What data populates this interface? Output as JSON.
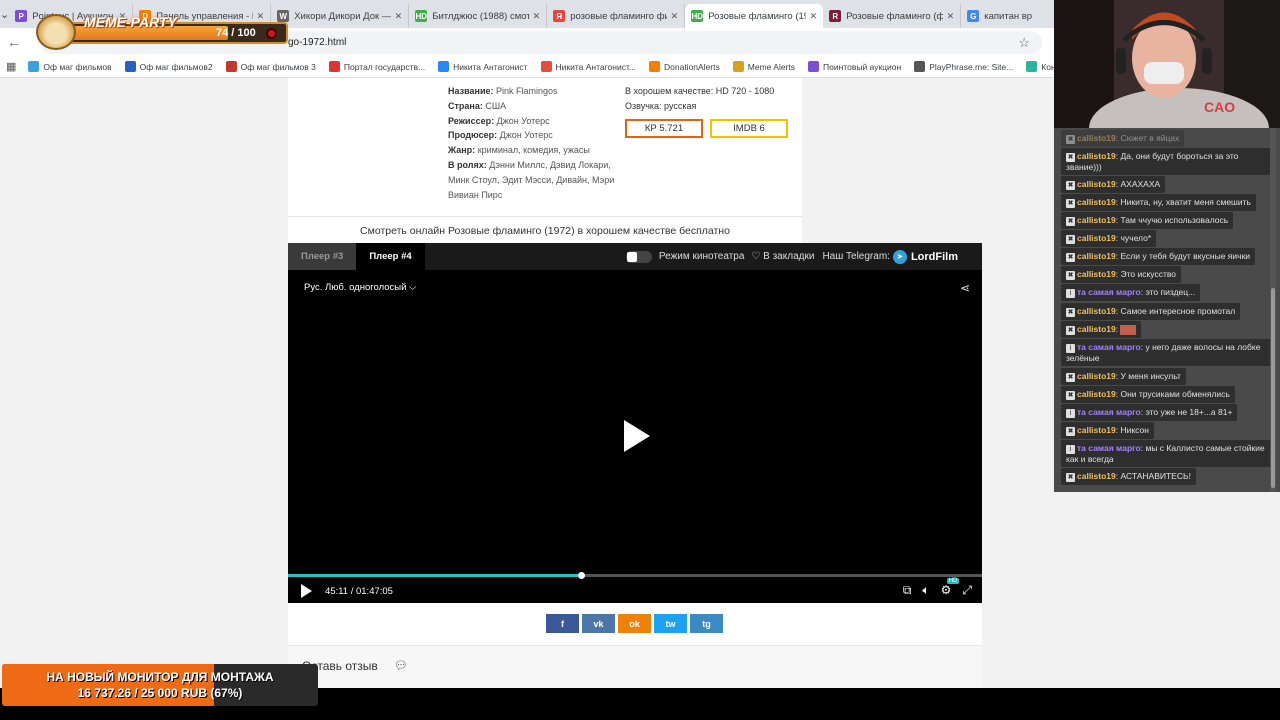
{
  "browser": {
    "tabs": [
      {
        "title": "Pointauc | Аукцион для",
        "fav": "P",
        "color": "#7a4fd6"
      },
      {
        "title": "Панель управления - Do",
        "fav": "D",
        "color": "#f57d00"
      },
      {
        "title": "Хикори Дикори Док — В",
        "fav": "W",
        "color": "#666666"
      },
      {
        "title": "Битлджюс (1988) смотре",
        "fav": "HD",
        "color": "#3fae49"
      },
      {
        "title": "розовые фламинго филь",
        "fav": "Я",
        "color": "#e8453c"
      },
      {
        "title": "Розовые фламинго (1972",
        "fav": "HD",
        "color": "#3fae49"
      },
      {
        "title": "Розовые фламинго (фил",
        "fav": "R",
        "color": "#7a1f3a"
      },
      {
        "title": "капитан вр",
        "fav": "G",
        "color": "#4285f4"
      }
    ],
    "active_tab": 5,
    "url": "go-1972.html",
    "bookmarks": [
      {
        "label": "Оф маг фильмов",
        "color": "#3aa0e0"
      },
      {
        "label": "Оф маг фильмов2",
        "color": "#2a60c0"
      },
      {
        "label": "Оф маг фильмов 3",
        "color": "#c0392b"
      },
      {
        "label": "Портал государств...",
        "color": "#d33"
      },
      {
        "label": "Никита Антагонист",
        "color": "#2787f5"
      },
      {
        "label": "Никита Антагонист...",
        "color": "#e74c3c"
      },
      {
        "label": "DonationAlerts",
        "color": "#f57d00"
      },
      {
        "label": "Meme Alerts",
        "color": "#d6a21e"
      },
      {
        "label": "Поинтовый аукцион",
        "color": "#7a4fd6"
      },
      {
        "label": "PlayPhrase.me: Site...",
        "color": "#555555"
      },
      {
        "label": "Контур.Сайн – Док...",
        "color": "#2ab5a0"
      }
    ]
  },
  "movie": {
    "info_left": [
      {
        "k": "Название:",
        "v": "Pink Flamingos"
      },
      {
        "k": "Страна:",
        "v": "США"
      },
      {
        "k": "Режиссер:",
        "v": "Джон Уотерс"
      },
      {
        "k": "Продюсер:",
        "v": "Джон Уотерс"
      },
      {
        "k": "Жанр:",
        "v": "криминал, комедия, ужасы"
      },
      {
        "k": "В ролях:",
        "v": "Дэнни Миллс, Дэвид Локари, Минк Стоул, Эдит Мэсси, Дивайн, Мэри Вивиан Пирс"
      }
    ],
    "quality": "В хорошем качестве: HD 720 - 1080",
    "voice": "Озвучка: русская",
    "kp": "КР 5.721",
    "imdb": "IMDB 6",
    "subtitle": "Смотреть онлайн Розовые фламинго (1972) в хорошем качестве бесплатно"
  },
  "player": {
    "tab3": "Плеер #3",
    "tab4": "Плеер #4",
    "cinema_mode": "Режим кинотеатра",
    "bookmarks": "♡ В закладки",
    "telegram": "Наш Telegram:",
    "brand": "LordFilm",
    "voice_track": "Рус. Люб. одноголосый",
    "time": "45:11 / 01:47:05",
    "progress": 0.422
  },
  "share_buttons": [
    {
      "label": "f",
      "color": "#3b5998"
    },
    {
      "label": "vk",
      "color": "#4a76a8"
    },
    {
      "label": "ok",
      "color": "#ee8208"
    },
    {
      "label": "tw",
      "color": "#1da1f2"
    },
    {
      "label": "tg",
      "color": "#3a8bc4"
    }
  ],
  "review_title": "Оставь отзыв",
  "chat": [
    {
      "user": "callisto19",
      "text": "Сюжет в яйцах",
      "kind": "a"
    },
    {
      "user": "callisto19",
      "text": "Да, они будут бороться за это звание)))",
      "kind": "a"
    },
    {
      "user": "callisto19",
      "text": "АХАХАХА",
      "kind": "a"
    },
    {
      "user": "callisto19",
      "text": "Никита, ну, хватит меня смешить",
      "kind": "a"
    },
    {
      "user": "callisto19",
      "text": "Там ччучю использовалось",
      "kind": "a"
    },
    {
      "user": "callisto19",
      "text": "чучело*",
      "kind": "a"
    },
    {
      "user": "callisto19",
      "text": "Если у тебя будут вкусные яички",
      "kind": "a"
    },
    {
      "user": "callisto19",
      "text": "Это искусство",
      "kind": "a"
    },
    {
      "user": "та самая марго",
      "text": "это пиздец...",
      "kind": "b"
    },
    {
      "user": "callisto19",
      "text": "Самое интересное промотал",
      "kind": "a"
    },
    {
      "user": "callisto19",
      "text": "",
      "kind": "a"
    },
    {
      "user": "та самая марго",
      "text": "у него даже волосы на лобке зелёные",
      "kind": "b"
    },
    {
      "user": "callisto19",
      "text": "У меня инсульт",
      "kind": "a"
    },
    {
      "user": "callisto19",
      "text": "Они трусиками обменялись",
      "kind": "a"
    },
    {
      "user": "та самая марго",
      "text": "это уже не 18+...а 81+",
      "kind": "b"
    },
    {
      "user": "callisto19",
      "text": "Никсон",
      "kind": "a"
    },
    {
      "user": "та самая марго",
      "text": "мы с Каллисто самые стойкие как и всегда",
      "kind": "b"
    },
    {
      "user": "callisto19",
      "text": "АСТАНАВИТЕСЬ!",
      "kind": "a"
    }
  ],
  "meme_party": {
    "label": "MEME-PARTY",
    "value": "74 / 100",
    "progress": 0.74
  },
  "goal": {
    "title": "НА НОВЫЙ МОНИТОР ДЛЯ МОНТАЖА",
    "amount": "16 737.26 / 25 000 RUB (67%)",
    "progress": 0.67
  }
}
